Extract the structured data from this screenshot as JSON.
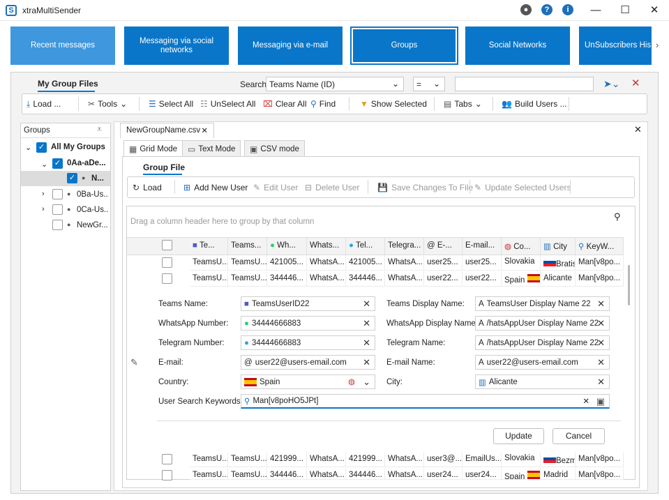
{
  "window": {
    "title": "xtraMultiSender"
  },
  "nav": [
    "Recent messages",
    "Messaging via social networks",
    "Messaging via e-mail",
    "Groups",
    "Social Networks",
    "UnSubscribers His"
  ],
  "header": {
    "my_group_files": "My Group Files",
    "search_label": "Search",
    "search_field": "Teams Name (ID)",
    "operator": "=",
    "search_value": ""
  },
  "toolbar": {
    "load": "Load ...",
    "tools": "Tools",
    "select_all": "Select All",
    "unselect_all": "UnSelect All",
    "clear_all": "Clear All",
    "find": "Find",
    "show_selected": "Show Selected",
    "tabs": "Tabs",
    "build_users": "Build Users ..."
  },
  "groups": {
    "title": "Groups",
    "items": [
      "All My Groups",
      "0Aa-aDe...",
      "N...",
      "0Ba-Us...",
      "0Ca-Us...",
      "NewGr..."
    ]
  },
  "file_tab": "NewGroupName.csv",
  "modes": [
    "Grid Mode",
    "Text Mode",
    "CSV mode"
  ],
  "group_file": {
    "title": "Group File",
    "load": "Load",
    "add_user": "Add New User",
    "edit_user": "Edit User",
    "delete_user": "Delete User",
    "save_changes": "Save Changes To File",
    "update_selected": "Update Selected Users"
  },
  "grid": {
    "drag_hint": "Drag a column header here to group by that column",
    "columns": [
      "Te...",
      "Teams...",
      "Wh...",
      "Whats...",
      "Tel...",
      "Telegra...",
      "E-...",
      "E-mail...",
      "Co...",
      "City",
      "KeyW..."
    ],
    "rows": [
      [
        "TeamsU...",
        "TeamsU...",
        "421005...",
        "WhatsA...",
        "421005...",
        "WhatsA...",
        "user25...",
        "user25...",
        "Slovakia",
        "Bratisl...",
        "Man[v8po..."
      ],
      [
        "TeamsU...",
        "TeamsU...",
        "344446...",
        "WhatsA...",
        "344446...",
        "WhatsA...",
        "user22...",
        "user22...",
        "Spain",
        "Alicante",
        "Man[v8po..."
      ],
      [
        "TeamsU...",
        "TeamsU...",
        "421999...",
        "WhatsA...",
        "421999...",
        "WhatsA...",
        "user3@...",
        "EmailUs...",
        "Slovakia",
        "Bezma...",
        "Man[v8po..."
      ],
      [
        "TeamsU...",
        "TeamsU...",
        "344446...",
        "WhatsA...",
        "344446...",
        "WhatsA...",
        "user24...",
        "user24...",
        "Spain",
        "Madrid",
        "Man[v8po..."
      ]
    ]
  },
  "form": {
    "teams_name_label": "Teams Name:",
    "teams_name": "TeamsUserID22",
    "teams_display_label": "Teams Display Name:",
    "teams_display": "TeamsUser Display Name 22",
    "whatsapp_label": "WhatsApp Number:",
    "whatsapp": "34444666883",
    "whatsapp_display_label": "WhatsApp Display Name:",
    "whatsapp_display": "/hatsAppUser Display Name 22",
    "telegram_label": "Telegram Number:",
    "telegram": "34444666883",
    "telegram_name_label": "Telegram Name:",
    "telegram_name": "/hatsAppUser Display Name 22",
    "email_label": "E-mail:",
    "email": "user22@users-email.com",
    "email_name_label": "E-mail Name:",
    "email_name": "user22@users-email.com",
    "country_label": "Country:",
    "country": "Spain",
    "city_label": "City:",
    "city": "Alicante",
    "keywords_label": "User Search Keywords:",
    "keywords": "Man[v8poHO5JPt]",
    "update": "Update",
    "cancel": "Cancel"
  }
}
